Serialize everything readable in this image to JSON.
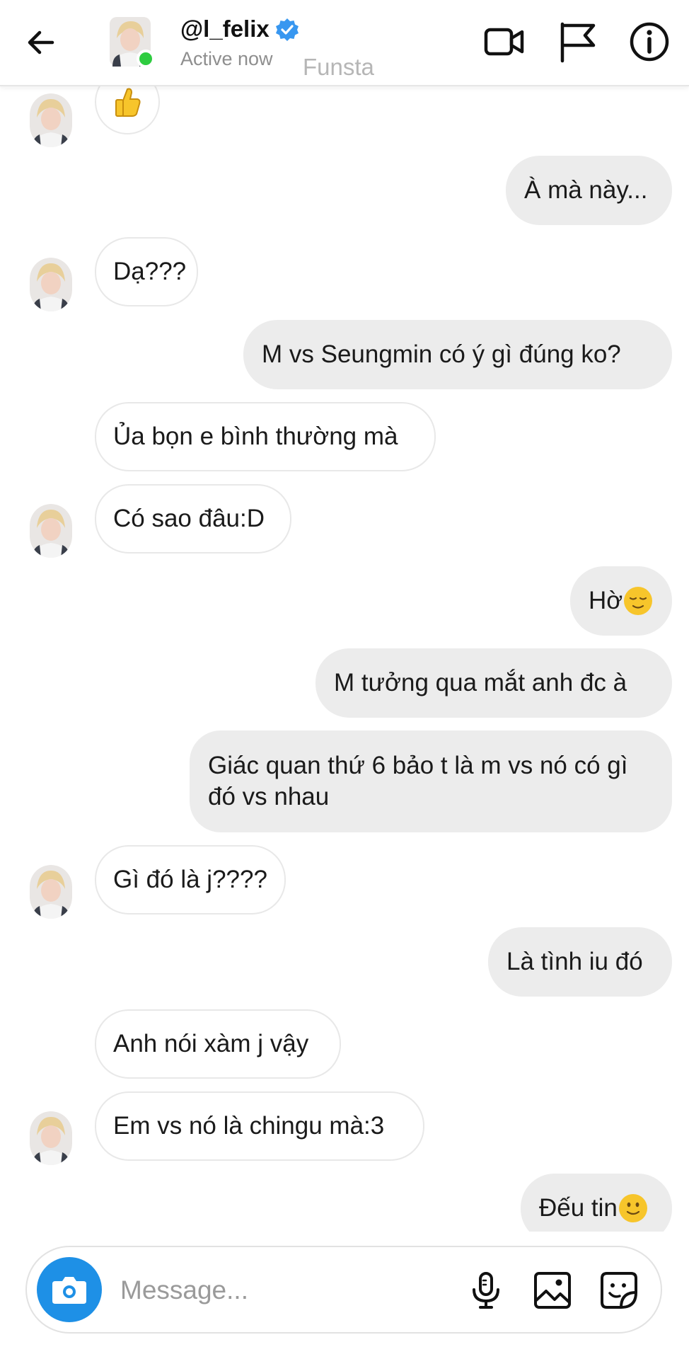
{
  "header": {
    "username": "@l_felix",
    "status": "Active now",
    "watermark": "Funsta",
    "icons": [
      "back-arrow-icon",
      "verified-badge-icon",
      "video-call-icon",
      "flag-icon",
      "info-icon"
    ]
  },
  "messages": [
    {
      "side": "in",
      "text": "👍",
      "avatar": true
    },
    {
      "side": "out",
      "text": "À mà này..."
    },
    {
      "side": "in",
      "text": "Dạ???",
      "avatar": true
    },
    {
      "side": "out",
      "text": "M vs Seungmin có ý gì đúng ko?"
    },
    {
      "side": "in",
      "text": "Ủa bọn e bình thường mà",
      "avatar": false
    },
    {
      "side": "in",
      "text": "Có sao đâu:D",
      "avatar": true
    },
    {
      "side": "out",
      "text": "Hờ",
      "emoji": "relieved-face"
    },
    {
      "side": "out",
      "text": "M tưởng qua mắt anh đc à"
    },
    {
      "side": "out",
      "text": "Giác quan thứ 6 bảo t là m vs nó có gì đó vs nhau"
    },
    {
      "side": "in",
      "text": "Gì đó là j????",
      "avatar": true
    },
    {
      "side": "out",
      "text": "Là tình iu đó"
    },
    {
      "side": "in",
      "text": "Anh nói xàm j vậy",
      "avatar": false
    },
    {
      "side": "in",
      "text": "Em vs nó là chingu mà:3",
      "avatar": true
    },
    {
      "side": "out",
      "text": "Đếu tin",
      "emoji": "slightly-smiling-face"
    }
  ],
  "composer": {
    "placeholder": "Message...",
    "icons": [
      "camera-icon",
      "microphone-icon",
      "gallery-icon",
      "sticker-icon"
    ]
  },
  "colors": {
    "accent": "#1e90e6",
    "online": "#2ecc40",
    "outgoing_bubble": "#ececec",
    "incoming_border": "#e8e8e8"
  }
}
